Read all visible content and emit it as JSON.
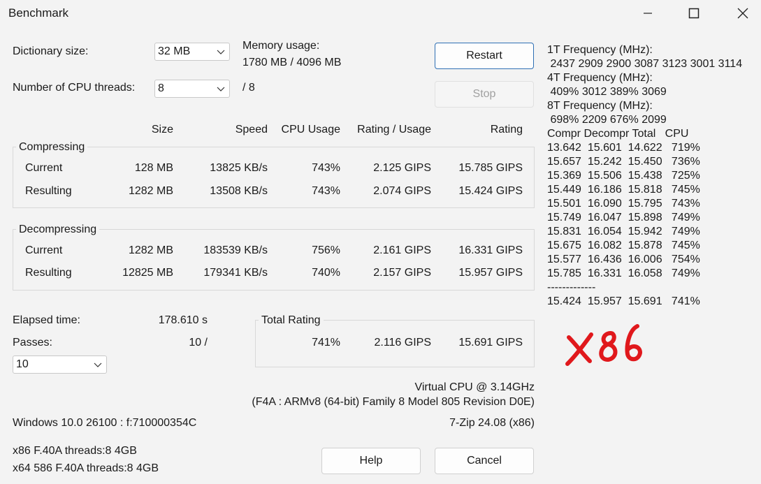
{
  "window": {
    "title": "Benchmark"
  },
  "settings": {
    "dict_label": "Dictionary size:",
    "dict_value": "32 MB",
    "threads_label": "Number of CPU threads:",
    "threads_value": "8",
    "threads_max": "/ 8",
    "mem_label": "Memory usage:",
    "mem_value": "1780 MB / 4096 MB"
  },
  "buttons": {
    "restart": "Restart",
    "stop": "Stop",
    "help": "Help",
    "cancel": "Cancel"
  },
  "table": {
    "headers": [
      "Size",
      "Speed",
      "CPU Usage",
      "Rating / Usage",
      "Rating"
    ],
    "compressing": {
      "label": "Compressing",
      "rows": [
        {
          "name": "Current",
          "size": "128 MB",
          "speed": "13825 KB/s",
          "cpu": "743%",
          "rpu": "2.125 GIPS",
          "rating": "15.785 GIPS"
        },
        {
          "name": "Resulting",
          "size": "1282 MB",
          "speed": "13508 KB/s",
          "cpu": "743%",
          "rpu": "2.074 GIPS",
          "rating": "15.424 GIPS"
        }
      ]
    },
    "decompressing": {
      "label": "Decompressing",
      "rows": [
        {
          "name": "Current",
          "size": "1282 MB",
          "speed": "183539 KB/s",
          "cpu": "756%",
          "rpu": "2.161 GIPS",
          "rating": "16.331 GIPS"
        },
        {
          "name": "Resulting",
          "size": "12825 MB",
          "speed": "179341 KB/s",
          "cpu": "740%",
          "rpu": "2.157 GIPS",
          "rating": "15.957 GIPS"
        }
      ]
    }
  },
  "elapsed": {
    "label": "Elapsed time:",
    "value": "178.610 s"
  },
  "passes": {
    "label": "Passes:",
    "value": "10 /",
    "select": "10"
  },
  "total": {
    "label": "Total Rating",
    "cpu": "741%",
    "rpu": "2.116 GIPS",
    "rating": "15.691 GIPS"
  },
  "cpu_info": {
    "line1": "Virtual CPU @ 3.14GHz",
    "line2": "(F4A : ARMv8 (64-bit) Family 8 Model 805 Revision D0E)"
  },
  "os_info": "Windows 10.0 26100 :  f:710000354C",
  "version": "7-Zip 24.08 (x86)",
  "arch_lines": [
    "x86 F.40A threads:8 4GB",
    "x64 586 F.40A threads:8 4GB"
  ],
  "log": {
    "lines": [
      "1T Frequency (MHz):",
      " 2437 2909 2900 3087 3123 3001 3114",
      "4T Frequency (MHz):",
      " 409% 3012 389% 3069",
      "8T Frequency (MHz):",
      " 698% 2209 676% 2099",
      "Compr Decompr Total   CPU",
      "13.642  15.601  14.622   719%",
      "15.657  15.242  15.450   736%",
      "15.369  15.506  15.438   725%",
      "15.449  16.186  15.818   745%",
      "15.501  16.090  15.795   743%",
      "15.749  16.047  15.898   749%",
      "15.831  16.054  15.942   749%",
      "15.675  16.082  15.878   745%",
      "15.577  16.436  16.006   754%",
      "15.785  16.331  16.058   749%",
      "-------------",
      "15.424  15.957  15.691   741%"
    ]
  },
  "annotation": {
    "text": "x86",
    "color": "#e0181c"
  }
}
